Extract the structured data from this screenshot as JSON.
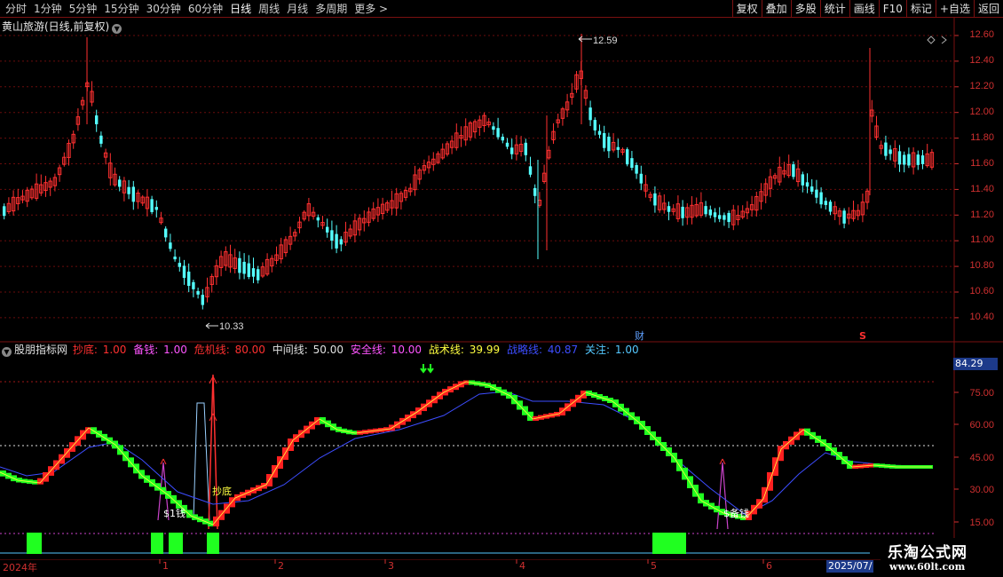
{
  "toolbar": {
    "periods": [
      "分时",
      "1分钟",
      "5分钟",
      "15分钟",
      "30分钟",
      "60分钟",
      "日线",
      "周线",
      "月线",
      "多周期"
    ],
    "active_period": "日线",
    "more_label": "更多 >",
    "right_buttons": [
      "复权",
      "叠加",
      "多股",
      "统计",
      "画线",
      "F10",
      "标记",
      "+自选",
      "返回"
    ]
  },
  "main_chart": {
    "title": "黄山旅游(日线,前复权)",
    "y_ticks": [
      "12.60",
      "12.40",
      "12.20",
      "12.00",
      "11.80",
      "11.60",
      "11.40",
      "11.20",
      "11.00",
      "10.80",
      "10.60",
      "10.40"
    ],
    "high_label": "12.59",
    "low_label": "10.33",
    "event_labels": {
      "fin": "财",
      "s": "S"
    },
    "colors": {
      "up": "#ff3030",
      "down": "#54ffff",
      "grid": "#7a1010"
    }
  },
  "indicator": {
    "name": "股朋指标网",
    "params": [
      {
        "label": "抄底:",
        "value": "1.00",
        "color": "#ff3030"
      },
      {
        "label": "备钱:",
        "value": "1.00",
        "color": "#ff55ff"
      },
      {
        "label": "危机线:",
        "value": "80.00",
        "color": "#ff3030"
      },
      {
        "label": "中间线:",
        "value": "50.00",
        "color": "#e0e0e0"
      },
      {
        "label": "安全线:",
        "value": "10.00",
        "color": "#ff55ff"
      },
      {
        "label": "战术线:",
        "value": "39.99",
        "color": "#ffff40"
      },
      {
        "label": "战略线:",
        "value": "40.87",
        "color": "#3d4dff"
      },
      {
        "label": "关注:",
        "value": "1.00",
        "color": "#54c8ff"
      }
    ],
    "y_ticks": [
      "75.00",
      "60.00",
      "45.00",
      "30.00",
      "15.00"
    ],
    "current_value": "84.29",
    "annotations": {
      "buy": "抄底",
      "money_left": "$1钱",
      "money_right": "$备钱"
    }
  },
  "x_axis": {
    "labels": [
      "2024年",
      "1",
      "2",
      "3",
      "4",
      "5",
      "6"
    ],
    "current_date": "2025/07/"
  },
  "watermark": {
    "title": "乐淘公式网",
    "url": "www.60lt.com"
  }
}
